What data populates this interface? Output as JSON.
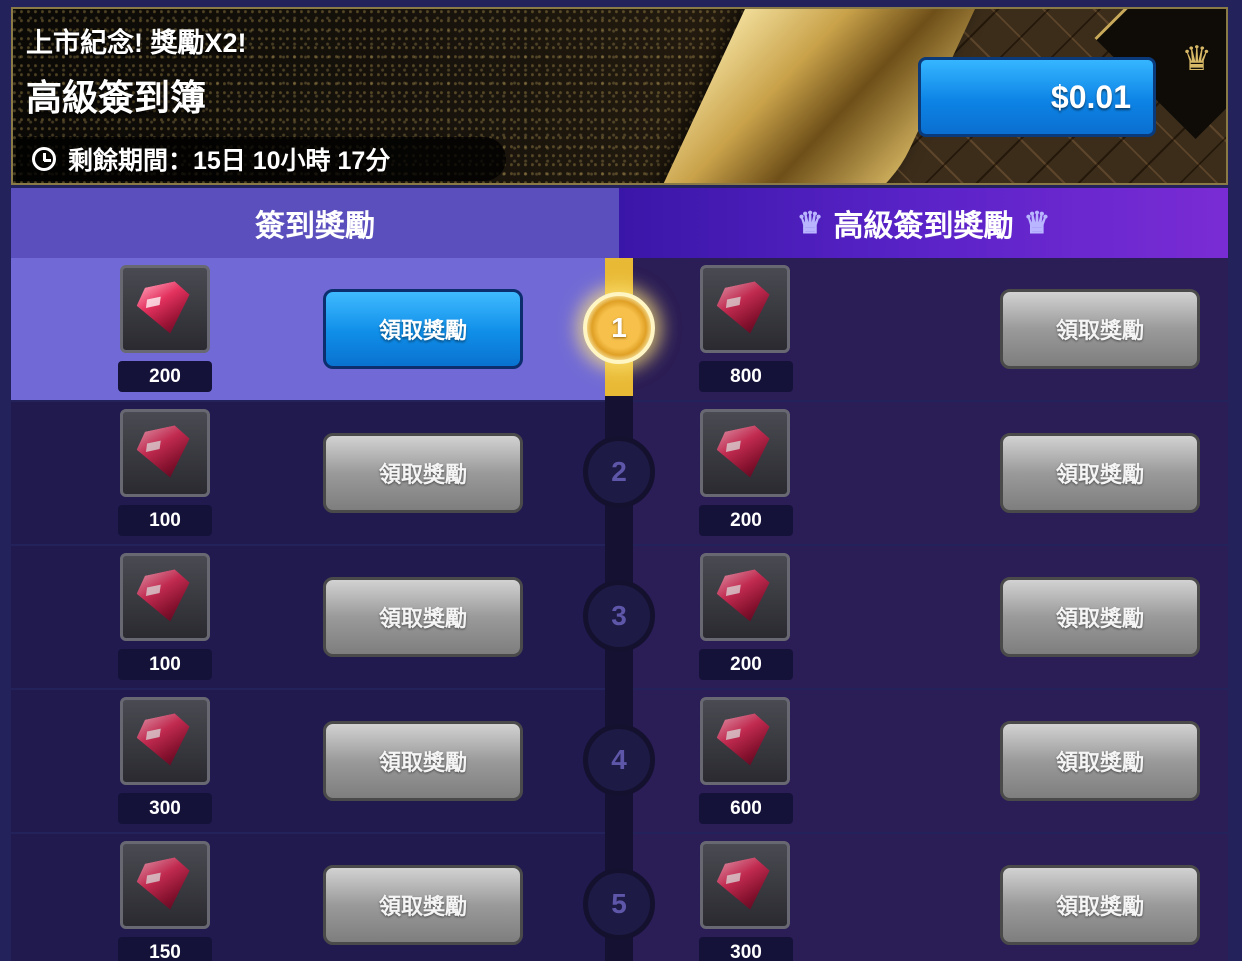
{
  "banner": {
    "promo": "上市紀念! 獎勵X2!",
    "title": "高級簽到簿",
    "timer": "剩餘期間：15日 10小時 17分",
    "price_button": "$0.01"
  },
  "tabs": {
    "normal": "簽到獎勵",
    "premium": "高級簽到獎勵"
  },
  "claim_label": "領取獎勵",
  "days": [
    {
      "day": "1",
      "normal_qty": "200",
      "premium_qty": "800",
      "normal_claimable": true
    },
    {
      "day": "2",
      "normal_qty": "100",
      "premium_qty": "200",
      "normal_claimable": false
    },
    {
      "day": "3",
      "normal_qty": "100",
      "premium_qty": "200",
      "normal_claimable": false
    },
    {
      "day": "4",
      "normal_qty": "300",
      "premium_qty": "600",
      "normal_claimable": false
    },
    {
      "day": "5",
      "normal_qty": "150",
      "premium_qty": "300",
      "normal_claimable": false
    }
  ],
  "icons": {
    "reward_item": "ruby-gem-icon",
    "timer": "clock-icon",
    "premium_tab": "crown-icon"
  },
  "colors": {
    "claim_active": "#0f8ee8",
    "claim_inactive": "#9a9a9a",
    "progress": "#e8b935",
    "normal_header": "#5a4fbd",
    "premium_header": "#5a23c8"
  }
}
